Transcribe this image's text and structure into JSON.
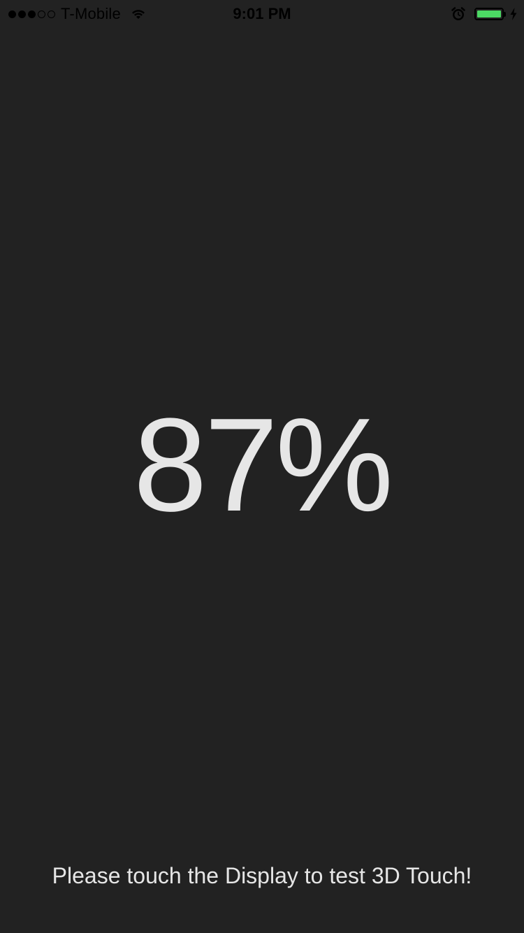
{
  "status_bar": {
    "carrier": "T-Mobile",
    "time": "9:01 PM",
    "signal_bars_filled": 3,
    "signal_bars_total": 5,
    "battery_level_fraction": 1.0,
    "battery_color": "#4cd964",
    "icons": [
      "signal-dots",
      "wifi-icon",
      "alarm-icon",
      "battery-icon",
      "charging-bolt-icon"
    ]
  },
  "main": {
    "pressure_value": "87%",
    "instruction": "Please touch the Display to test 3D Touch!"
  },
  "colors": {
    "background": "#222222",
    "text": "#e6e6e6"
  }
}
